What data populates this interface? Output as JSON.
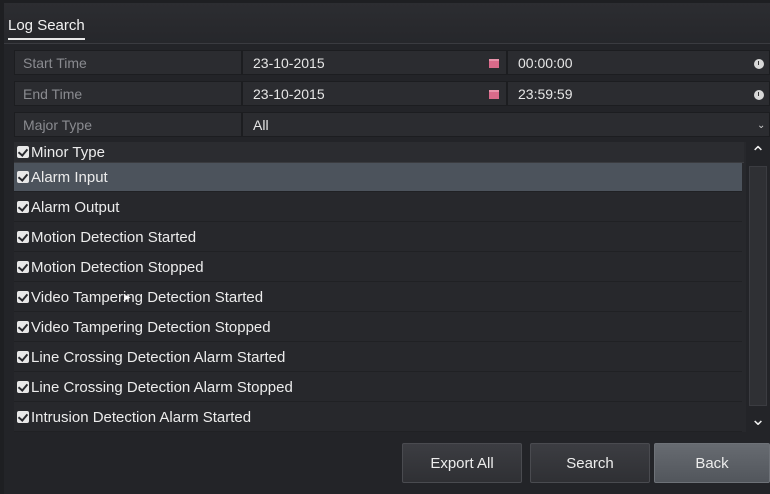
{
  "window": {
    "tab_title": "Log Search"
  },
  "fields": {
    "start_time": {
      "label": "Start Time",
      "date": "23-10-2015",
      "time": "00:00:00"
    },
    "end_time": {
      "label": "End Time",
      "date": "23-10-2015",
      "time": "23:59:59"
    },
    "major_type": {
      "label": "Major Type",
      "value": "All"
    }
  },
  "minor": {
    "header": "Minor Type",
    "items": [
      {
        "label": "Alarm Input",
        "checked": true,
        "selected": true
      },
      {
        "label": "Alarm Output",
        "checked": true
      },
      {
        "label": "Motion Detection Started",
        "checked": true
      },
      {
        "label": "Motion Detection Stopped",
        "checked": true
      },
      {
        "label": "Video Tampering Detection Started",
        "checked": true
      },
      {
        "label": "Video Tampering Detection Stopped",
        "checked": true
      },
      {
        "label": "Line Crossing Detection Alarm Started",
        "checked": true
      },
      {
        "label": "Line Crossing Detection Alarm Stopped",
        "checked": true
      },
      {
        "label": "Intrusion Detection Alarm Started",
        "checked": true
      }
    ]
  },
  "buttons": {
    "export_all": "Export All",
    "search": "Search",
    "back": "Back"
  },
  "icons": {
    "calendar": "calendar-icon",
    "clock": "clock-icon",
    "dropdown": "chevron-down-icon",
    "scroll_up": "chevron-up-icon",
    "scroll_down": "chevron-down-icon"
  },
  "colors": {
    "background": "#232428",
    "selected_row": "#4c535c",
    "calendar_icon": "#d96a8a",
    "back_button": "#5e6268"
  }
}
